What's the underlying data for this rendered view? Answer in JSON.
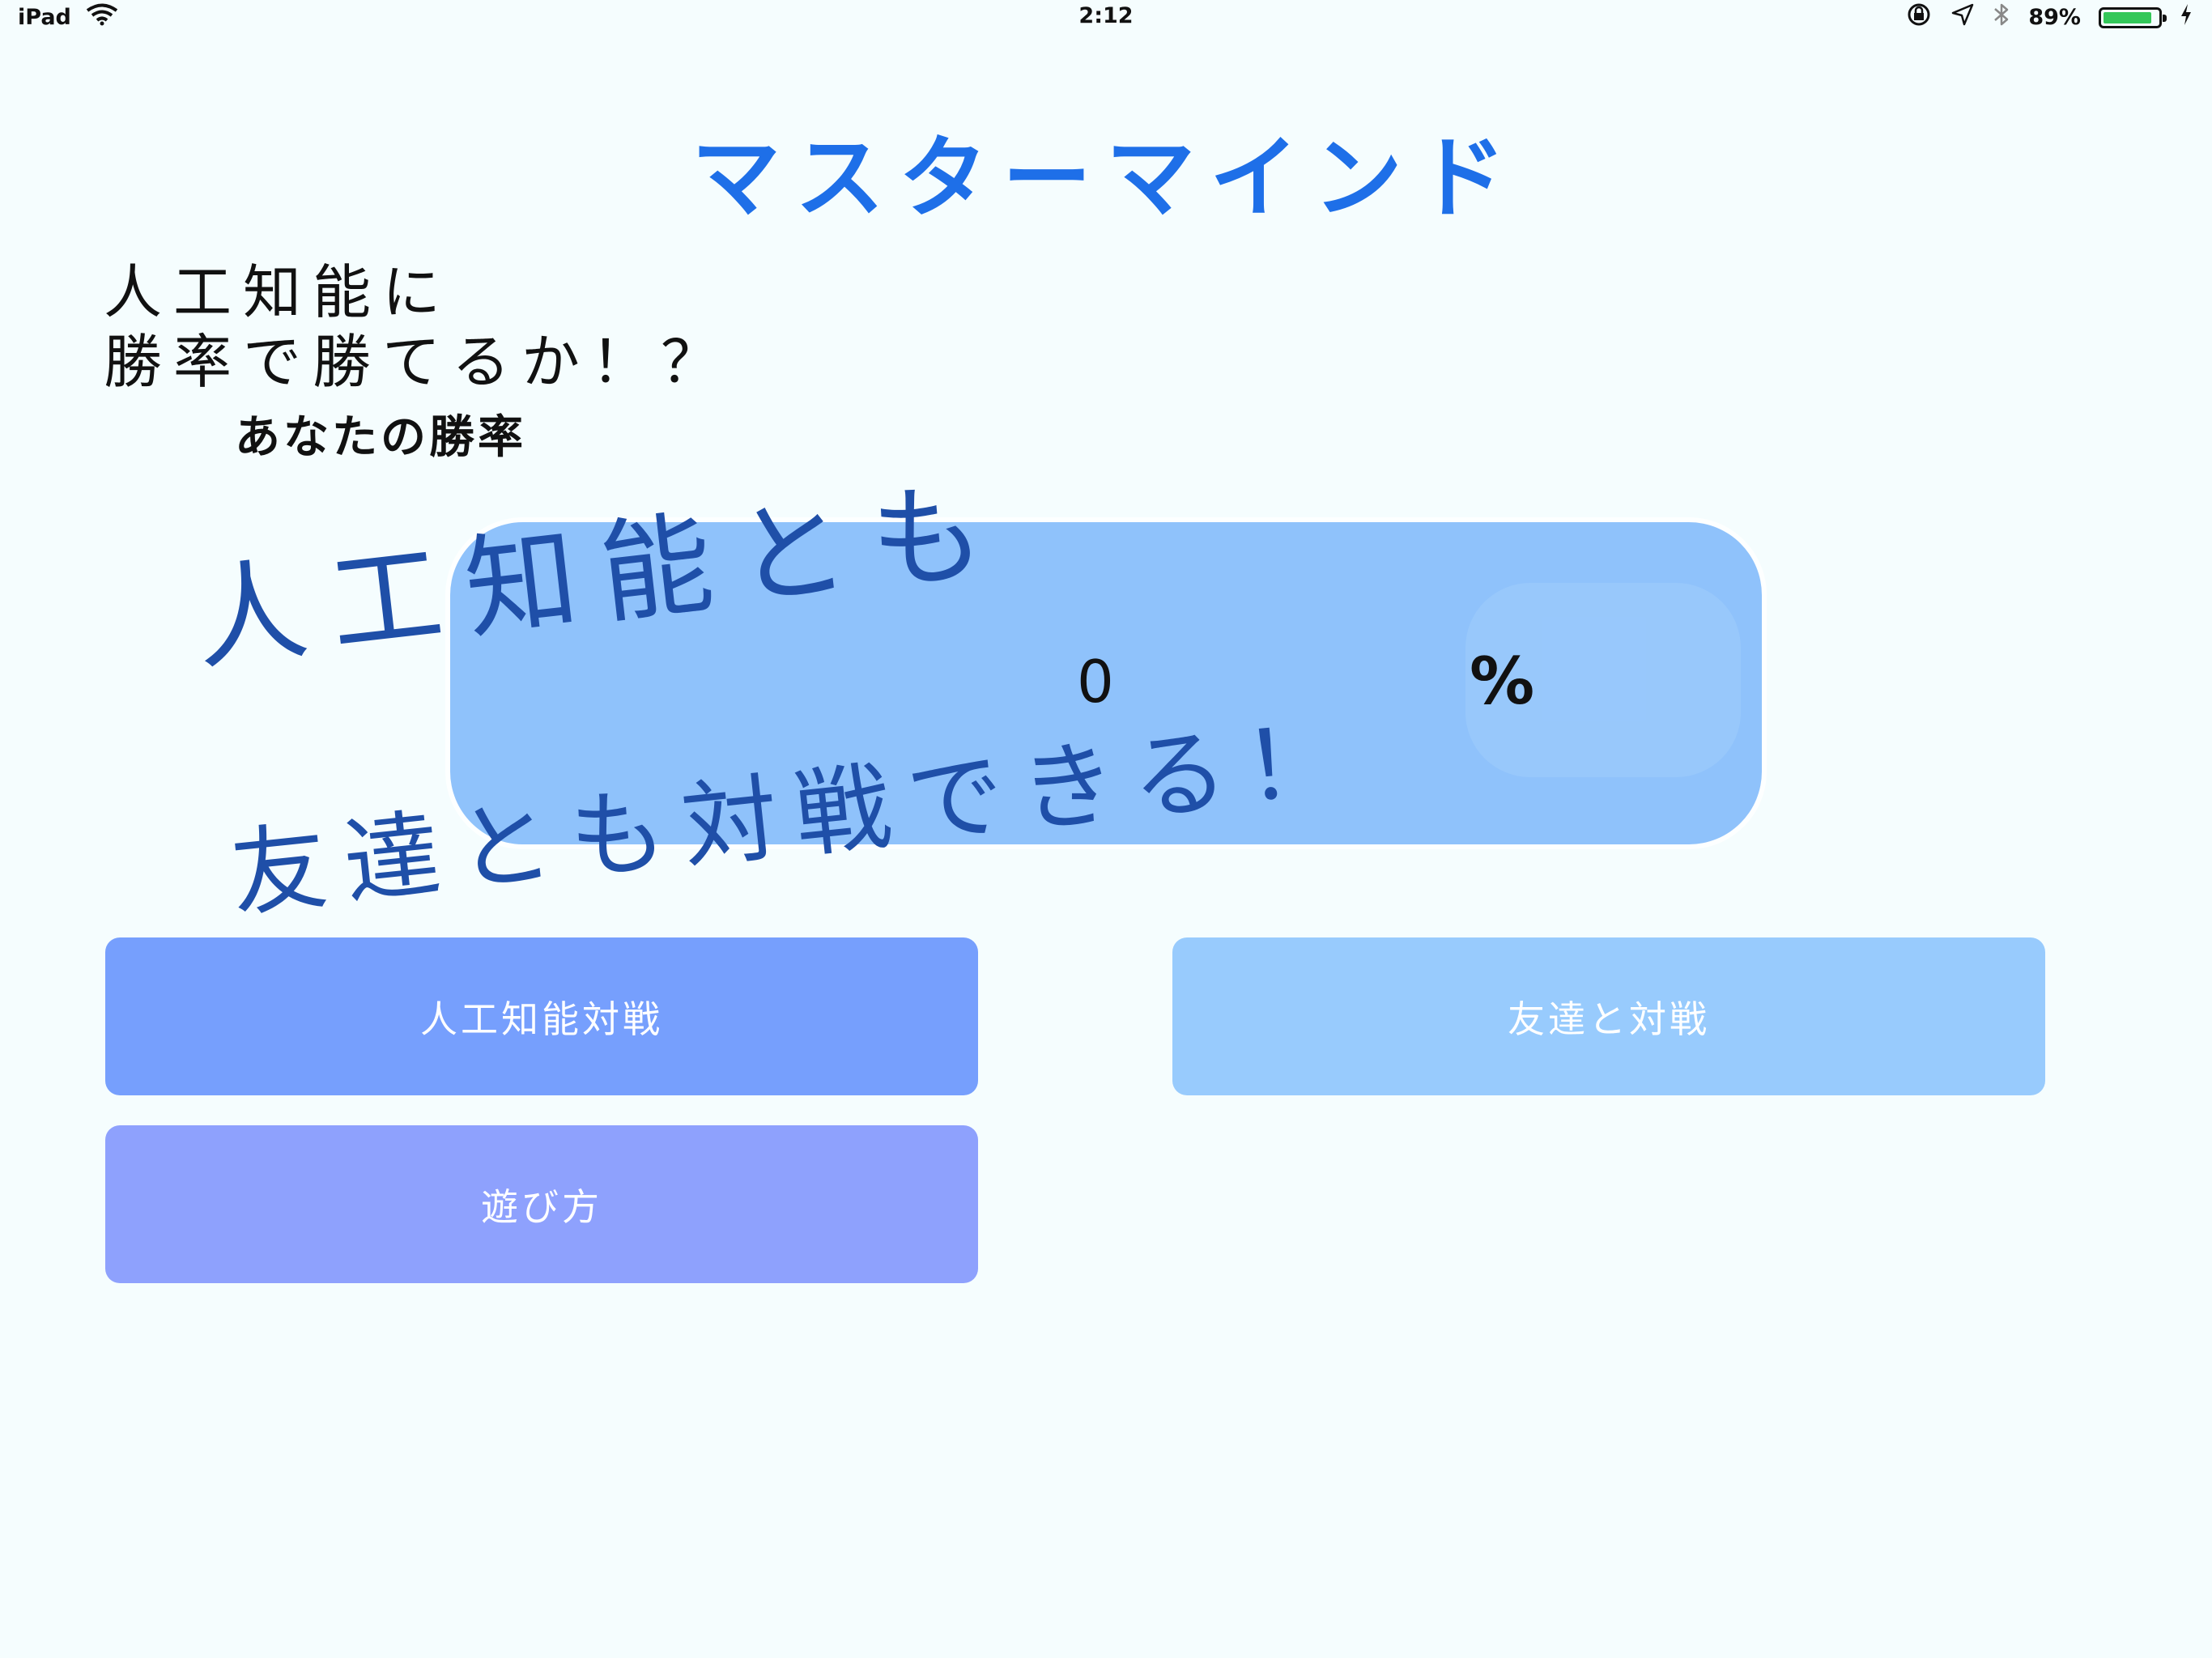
{
  "status_bar": {
    "device": "iPad",
    "time": "2:12",
    "battery_text": "89%",
    "battery_level": 0.89,
    "icons": [
      "wifi-icon",
      "rotation-lock-icon",
      "location-icon",
      "bluetooth-icon",
      "charging-icon"
    ]
  },
  "app": {
    "title": "マスターマインド"
  },
  "tagline": {
    "line1": "人工知能に",
    "line2": "勝率で勝てるか！？"
  },
  "winrate": {
    "label": "あなたの勝率",
    "value": "0",
    "unit": "%"
  },
  "promo": {
    "top": "人工知能とも",
    "bottom": "友達とも対戦できる！"
  },
  "buttons": {
    "ai_battle": "人工知能対戦",
    "friend_battle": "友達と対戦",
    "how_to_play": "遊び方"
  },
  "colors": {
    "background": "#f5fdfe",
    "title": "#1e6fe8",
    "promo_text": "#1f4fa8",
    "panel": "#8fc2fb",
    "ai_button": "#769ffd",
    "friend_button": "#98cbfd",
    "howto_button": "#8ea1fd",
    "battery_fill": "#34c759"
  }
}
